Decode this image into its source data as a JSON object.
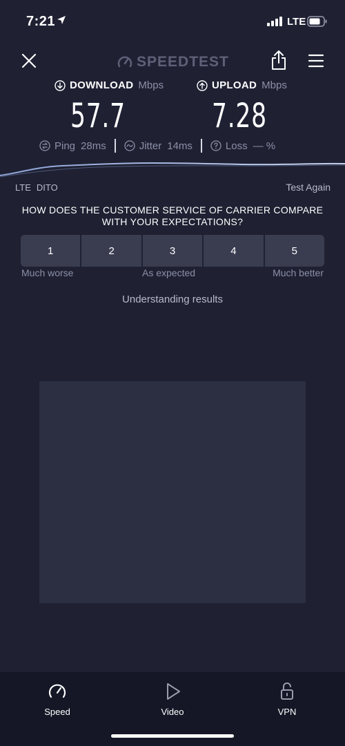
{
  "status_bar": {
    "time": "7:21",
    "network": "LTE"
  },
  "header": {
    "logo_text": "SPEEDTEST"
  },
  "download": {
    "label": "DOWNLOAD",
    "unit": "Mbps",
    "value": "57.7"
  },
  "upload": {
    "label": "UPLOAD",
    "unit": "Mbps",
    "value": "7.28"
  },
  "stats": {
    "ping_label": "Ping",
    "ping_value": "28ms",
    "jitter_label": "Jitter",
    "jitter_value": "14ms",
    "loss_label": "Loss",
    "loss_value": "— %"
  },
  "connection": {
    "type": "LTE",
    "carrier": "DITO",
    "test_again": "Test Again"
  },
  "survey": {
    "question": "HOW DOES THE CUSTOMER SERVICE OF CARRIER COMPARE WITH YOUR EXPECTATIONS?",
    "options": [
      "1",
      "2",
      "3",
      "4",
      "5"
    ],
    "label_low": "Much worse",
    "label_mid": "As expected",
    "label_high": "Much better"
  },
  "understanding_link": "Understanding results",
  "tabs": [
    {
      "label": "Speed",
      "icon": "gauge-icon"
    },
    {
      "label": "Video",
      "icon": "play-icon"
    },
    {
      "label": "VPN",
      "icon": "lock-icon"
    }
  ],
  "colors": {
    "background": "#1f2133",
    "tabbar": "#151726",
    "muted_text": "#8c8fa6",
    "rating_button": "#3a3d50"
  }
}
